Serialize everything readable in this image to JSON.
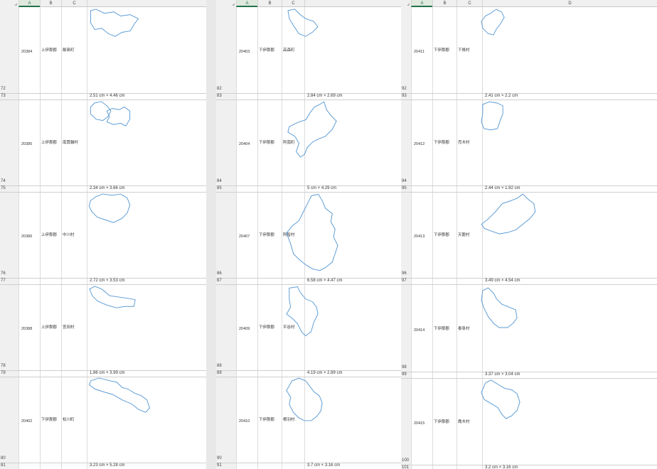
{
  "panes": [
    {
      "name": "pane-1",
      "columns": [
        "A",
        "B",
        "C",
        ""
      ],
      "rows": [
        {
          "top_num": "72",
          "bottom_num": "73",
          "code": "20384",
          "district": "上伊那郡",
          "town": "飯島町",
          "size": "2.51 cm × 4.46 cm",
          "shape": "s1"
        },
        {
          "top_num": "74",
          "bottom_num": "75",
          "code": "20385",
          "district": "上伊那郡",
          "town": "南箕輪村",
          "size": "2.34 cm × 3.66 cm",
          "shape": "s2"
        },
        {
          "top_num": "76",
          "bottom_num": "77",
          "code": "20386",
          "district": "上伊那郡",
          "town": "中川村",
          "size": "2.72 cm × 3.53 cm",
          "shape": "s3"
        },
        {
          "top_num": "78",
          "bottom_num": "79",
          "code": "20388",
          "district": "上伊那郡",
          "town": "宮田村",
          "size": "1.86 cm × 3.99 cm",
          "shape": "s4"
        },
        {
          "top_num": "80",
          "bottom_num": "81",
          "code": "20402",
          "district": "下伊那郡",
          "town": "松川町",
          "size": "3.23 cm × 5.28 cm",
          "shape": "s5"
        }
      ]
    },
    {
      "name": "pane-2",
      "columns": [
        "A",
        "B",
        "C",
        ""
      ],
      "rows": [
        {
          "top_num": "82",
          "bottom_num": "83",
          "code": "20403",
          "district": "下伊那郡",
          "town": "高森町",
          "size": "2.84 cm × 2.69 cm",
          "shape": "s6"
        },
        {
          "top_num": "84",
          "bottom_num": "85",
          "code": "20404",
          "district": "下伊那郡",
          "town": "阿南町",
          "size": "5 cm × 4.29 cm",
          "shape": "s7"
        },
        {
          "top_num": "86",
          "bottom_num": "87",
          "code": "20407",
          "district": "下伊那郡",
          "town": "阿智村",
          "size": "6.58 cm × 4.47 cm",
          "shape": "s8"
        },
        {
          "top_num": "88",
          "bottom_num": "89",
          "code": "20409",
          "district": "下伊那郡",
          "town": "平谷村",
          "size": "4.19 cm × 2.89 cm",
          "shape": "s9"
        },
        {
          "top_num": "90",
          "bottom_num": "91",
          "code": "20410",
          "district": "下伊那郡",
          "town": "根羽村",
          "size": "3.7 cm × 3.16 cm",
          "shape": "s10"
        }
      ]
    },
    {
      "name": "pane-3",
      "columns": [
        "A",
        "B",
        "C",
        "D"
      ],
      "rows": [
        {
          "top_num": "92",
          "bottom_num": "93",
          "code": "20411",
          "district": "下伊那郡",
          "town": "下條村",
          "size": "2.41 cm × 2.2 cm",
          "shape": "s11"
        },
        {
          "top_num": "94",
          "bottom_num": "95",
          "code": "20412",
          "district": "下伊那郡",
          "town": "売木村",
          "size": "2.44 cm × 1.92 cm",
          "shape": "s12"
        },
        {
          "top_num": "96",
          "bottom_num": "97",
          "code": "20413",
          "district": "下伊那郡",
          "town": "天龍村",
          "size": "3.49 cm × 4.54 cm",
          "shape": "s13"
        },
        {
          "top_num": "98",
          "bottom_num": "99",
          "code": "20414",
          "district": "下伊那郡",
          "town": "泰阜村",
          "size": "3.37 cm × 3.04 cm",
          "shape": "s14"
        },
        {
          "top_num": "100",
          "bottom_num": "101",
          "code": "20415",
          "district": "下伊那郡",
          "town": "喬木村",
          "size": "3.2 cm × 3.16 cm",
          "shape": "s15"
        }
      ]
    }
  ]
}
